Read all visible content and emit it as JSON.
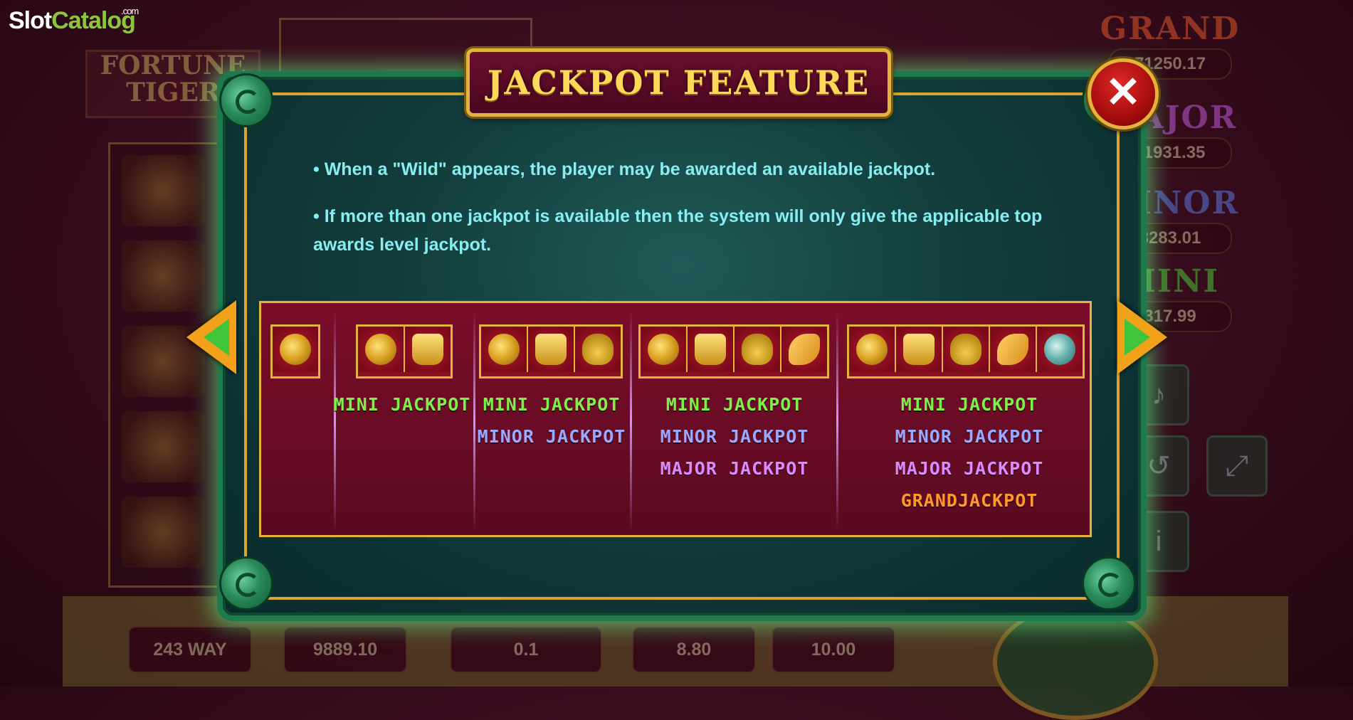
{
  "logo": {
    "slot": "Slot",
    "catalog": "Catalog",
    "com": ".com"
  },
  "background": {
    "game_title": "FORTUNE TIGER",
    "jackpots": [
      {
        "label": "GRAND",
        "value": "71250.17",
        "color": "#e0562a"
      },
      {
        "label": "MAJOR",
        "value": "11931.35",
        "color": "#c05ad8"
      },
      {
        "label": "MINOR",
        "value": "3283.01",
        "color": "#5a78e0"
      },
      {
        "label": "MINI",
        "value": "317.99",
        "color": "#4ac43a"
      }
    ],
    "bottom_bar": {
      "ways": "243 WAY",
      "balance": "9889.10",
      "denom": "0.1",
      "bet": "8.80",
      "win": "10.00"
    }
  },
  "dialog": {
    "title": "JACKPOT FEATURE",
    "close_label": "✕",
    "bullets": [
      "• When a \"Wild\" appears, the player may be awarded an available jackpot.",
      "• If more than one jackpot is available then the system will only give the applicable top awards level jackpot."
    ],
    "columns": [
      {
        "symbols": [
          "red-coin"
        ],
        "jackpots": []
      },
      {
        "symbols": [
          "red-coin",
          "gold-ingot"
        ],
        "jackpots": [
          "MINI JACKPOT"
        ]
      },
      {
        "symbols": [
          "red-coin",
          "gold-ingot",
          "gold-frog"
        ],
        "jackpots": [
          "MINI JACKPOT",
          "MINOR JACKPOT"
        ]
      },
      {
        "symbols": [
          "red-coin",
          "gold-ingot",
          "gold-frog",
          "gold-fish"
        ],
        "jackpots": [
          "MINI JACKPOT",
          "MINOR JACKPOT",
          "MAJOR JACKPOT"
        ]
      },
      {
        "symbols": [
          "red-coin",
          "gold-ingot",
          "gold-frog",
          "gold-fish",
          "jade-plate"
        ],
        "jackpots": [
          "MINI JACKPOT",
          "MINOR JACKPOT",
          "MAJOR JACKPOT",
          "GRANDJACKPOT"
        ]
      }
    ]
  },
  "colors": {
    "accent_gold": "#e2b43c",
    "frame_green": "#1e7a4c",
    "text_cyan": "#86eef0"
  }
}
